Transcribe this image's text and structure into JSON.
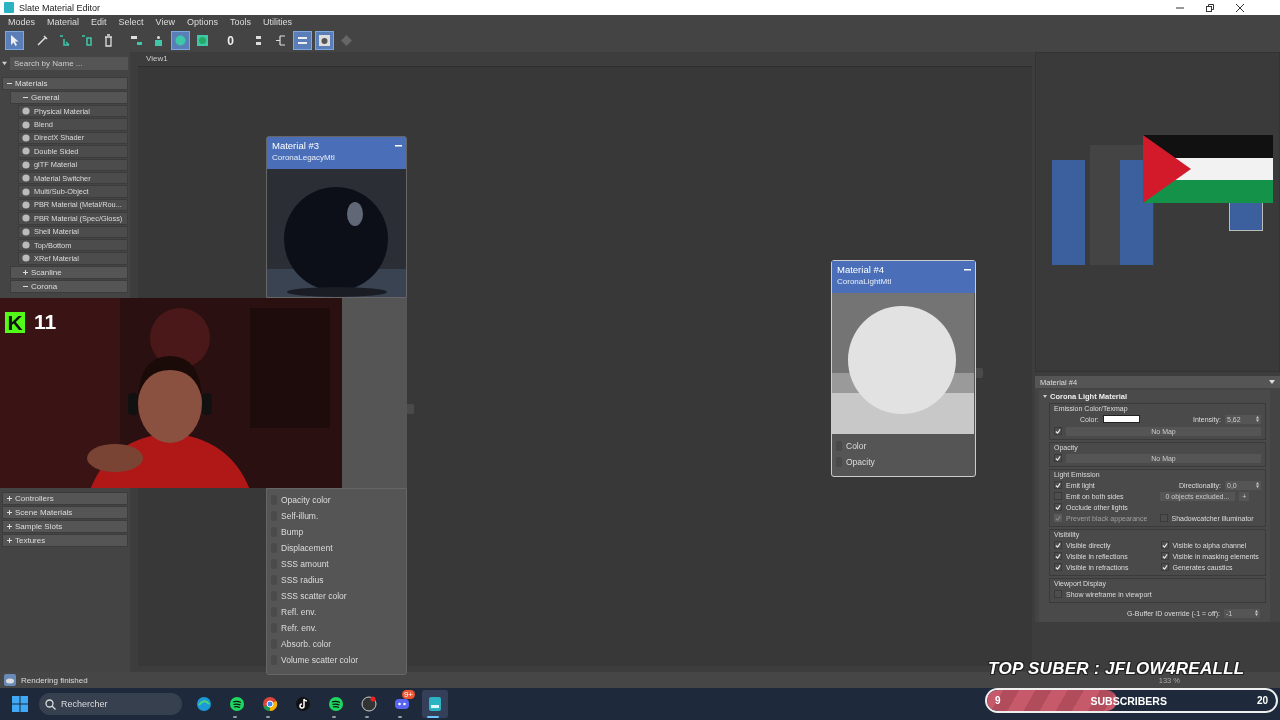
{
  "window": {
    "title": "Slate Material Editor"
  },
  "menu": [
    "Modes",
    "Material",
    "Edit",
    "Select",
    "View",
    "Options",
    "Tools",
    "Utilities"
  ],
  "toolbar": [
    {
      "kind": "select",
      "selected": true
    },
    {
      "kind": "eyedropper",
      "selected": false
    },
    {
      "kind": "pick",
      "selected": false
    },
    {
      "kind": "put",
      "selected": false
    },
    {
      "kind": "delete",
      "selected": false
    },
    {
      "kind": "layout",
      "selected": false
    },
    {
      "kind": "child",
      "selected": false
    },
    {
      "kind": "sphere",
      "selected": true
    },
    {
      "kind": "checker",
      "selected": false
    },
    {
      "kind": "number",
      "label": "0",
      "selected": false
    },
    {
      "kind": "nodes",
      "selected": false
    },
    {
      "kind": "tree",
      "selected": false
    },
    {
      "kind": "params",
      "selected": true
    },
    {
      "kind": "preview",
      "selected": true
    },
    {
      "kind": "grid",
      "selected": false
    }
  ],
  "browser": {
    "search": {
      "placeholder": "Search by Name ..."
    },
    "groups": [
      {
        "label": "Materials",
        "expanded": true,
        "children": [
          {
            "label": "General",
            "expanded": true,
            "children": [
              {
                "label": "Physical Material"
              },
              {
                "label": "Blend"
              },
              {
                "label": "DirectX Shader"
              },
              {
                "label": "Double Sided"
              },
              {
                "label": "glTF Material"
              },
              {
                "label": "Material Switcher"
              },
              {
                "label": "Multi/Sub-Object"
              },
              {
                "label": "PBR Material (Metal/Rou..."
              },
              {
                "label": "PBR Material (Spec/Gloss)"
              },
              {
                "label": "Shell Material"
              },
              {
                "label": "Top/Bottom"
              },
              {
                "label": "XRef Material"
              }
            ]
          },
          {
            "label": "Scanline",
            "expanded": false
          },
          {
            "label": "Corona",
            "expanded": true
          }
        ]
      },
      {
        "label": "Controllers",
        "expanded": false
      },
      {
        "label": "Scene Materials",
        "expanded": false
      },
      {
        "label": "Sample Slots",
        "expanded": false
      },
      {
        "label": "Textures",
        "expanded": false
      }
    ]
  },
  "view_tab": "View1",
  "nodes": [
    {
      "title": "Material #3",
      "type": "CoronaLegacyMtl",
      "slots": [
        "Opacity color",
        "Self-illum.",
        "Bump",
        "Displacement",
        "SSS amount",
        "SSS radius",
        "SSS scatter color",
        "Refl. env.",
        "Refr. env.",
        "Absorb. color",
        "Volume scatter color"
      ]
    },
    {
      "title": "Material #4",
      "type": "CoronaLightMtl",
      "slots": [
        "Color",
        "Opacity"
      ]
    }
  ],
  "parameters": {
    "header": "Material #4",
    "rollout": "Corona Light Material",
    "emission": {
      "title": "Emission Color/Texmap",
      "color_label": "Color:",
      "intensity_label": "Intensity:",
      "intensity": "5,62",
      "map_enabled": true,
      "map": "No Map"
    },
    "opacity": {
      "title": "Opacity",
      "map_enabled": true,
      "map": "No Map"
    },
    "light_emission": {
      "title": "Light Emission",
      "options": [
        {
          "label": "Emit light",
          "checked": true,
          "disabled": false
        },
        {
          "label": "Emit on both sides",
          "checked": false,
          "disabled": false
        },
        {
          "label": "Occlude other lights",
          "checked": true,
          "disabled": false
        },
        {
          "label": "Prevent black appearance",
          "checked": true,
          "disabled": true
        }
      ],
      "directionality_label": "Directionality:",
      "directionality": "0,0",
      "exclude": "0 objects excluded...",
      "add": "+",
      "shadowcatcher": {
        "label": "Shadowcatcher illuminator",
        "checked": false
      }
    },
    "visibility": {
      "title": "Visibility",
      "options": [
        {
          "label": "Visible directly",
          "checked": true
        },
        {
          "label": "Visible to alpha channel",
          "checked": true
        },
        {
          "label": "Visible in reflections",
          "checked": true
        },
        {
          "label": "Visible in masking elements",
          "checked": true
        },
        {
          "label": "Visible in refractions",
          "checked": true
        },
        {
          "label": "Generates caustics",
          "checked": true
        }
      ]
    },
    "viewport": {
      "title": "Viewport Display",
      "options": [
        {
          "label": "Show wireframe in viewport",
          "checked": false
        }
      ]
    },
    "gbuffer": {
      "label": "G-Buffer ID override (-1 = off):",
      "value": "-1"
    }
  },
  "status_bar": {
    "message": "Rendering finished",
    "zoom": "133 %"
  },
  "taskbar": {
    "search": {
      "placeholder": "Rechercher"
    },
    "apps": [
      {
        "kind": "browser",
        "running": false
      },
      {
        "kind": "music",
        "running": true
      },
      {
        "kind": "chrome",
        "running": true
      },
      {
        "kind": "note",
        "running": false
      },
      {
        "kind": "music",
        "running": true
      },
      {
        "kind": "record",
        "running": true
      },
      {
        "kind": "chat",
        "running": true,
        "badge": "9+"
      },
      {
        "kind": "editor",
        "running": true,
        "selected": true
      }
    ]
  },
  "overlays": {
    "webcam": {
      "logo": "K",
      "viewers": "11"
    },
    "top_sub": "TOP SUBER : JFLOW4REALLL",
    "sub_goal": {
      "current": "9",
      "label": "SUBSCRIBERS",
      "target": "20",
      "level": 0.45
    }
  }
}
